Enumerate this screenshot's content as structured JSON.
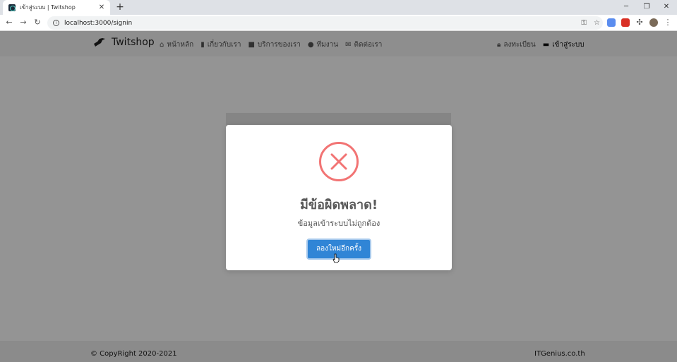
{
  "browser": {
    "tab_title": "เข้าสู่ระบบ | Twitshop",
    "tab_close": "✕",
    "new_tab": "+",
    "url": "localhost:3000/signin",
    "window_controls": [
      "─",
      "❐",
      "✕"
    ]
  },
  "navbar": {
    "brand": "Twitshop",
    "links": [
      {
        "icon": "home-icon",
        "label": "หน้าหลัก"
      },
      {
        "icon": "bookmark-icon",
        "label": "เกี่ยวกับเรา"
      },
      {
        "icon": "box-icon",
        "label": "บริการของเรา"
      },
      {
        "icon": "users-icon",
        "label": "ทีมงาน"
      },
      {
        "icon": "envelope-icon",
        "label": "ติดต่อเรา"
      }
    ],
    "right_links": [
      {
        "icon": "lock-icon",
        "label": "ลงทะเบียน"
      },
      {
        "icon": "book-icon",
        "label": "เข้าสู่ระบบ"
      }
    ]
  },
  "modal": {
    "title": "มีข้อผิดพลาด!",
    "text": "ข้อมูลเข้าระบบไม่ถูกต้อง",
    "button_label": "ลองใหม่อีกครั้ง"
  },
  "footer": {
    "copyright": "© CopyRight 2020-2021",
    "right": "ITGenius.co.th"
  },
  "colors": {
    "error": "#f27474",
    "button": "#3085d6"
  }
}
